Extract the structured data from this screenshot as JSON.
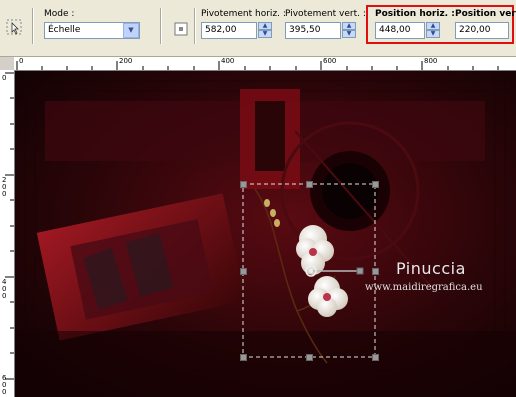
{
  "toolbar": {
    "mode": {
      "label": "Mode :",
      "value": "Échelle"
    },
    "pivot_h": {
      "label": "Pivotement horiz. :",
      "value": "582,00"
    },
    "pivot_v": {
      "label": "Pivotement vert. :",
      "value": "395,50"
    },
    "pos_h": {
      "label": "Position horiz. :",
      "value": "448,00"
    },
    "pos_v": {
      "label": "Position vert. :",
      "value": "220,00"
    }
  },
  "ruler": {
    "h_ticks": [
      "0",
      "200",
      "400",
      "600",
      "800"
    ],
    "v_ticks": [
      "0",
      "2\n0\n0",
      "4\n0\n0",
      "6\n0\n0"
    ]
  },
  "canvas": {
    "watermark_name": "Pinuccia",
    "watermark_url": "www.maidiregrafica.eu"
  },
  "colors": {
    "highlight": "#e01010",
    "canvas_bg": "#2a0508",
    "accent_red": "#8a0f18"
  }
}
